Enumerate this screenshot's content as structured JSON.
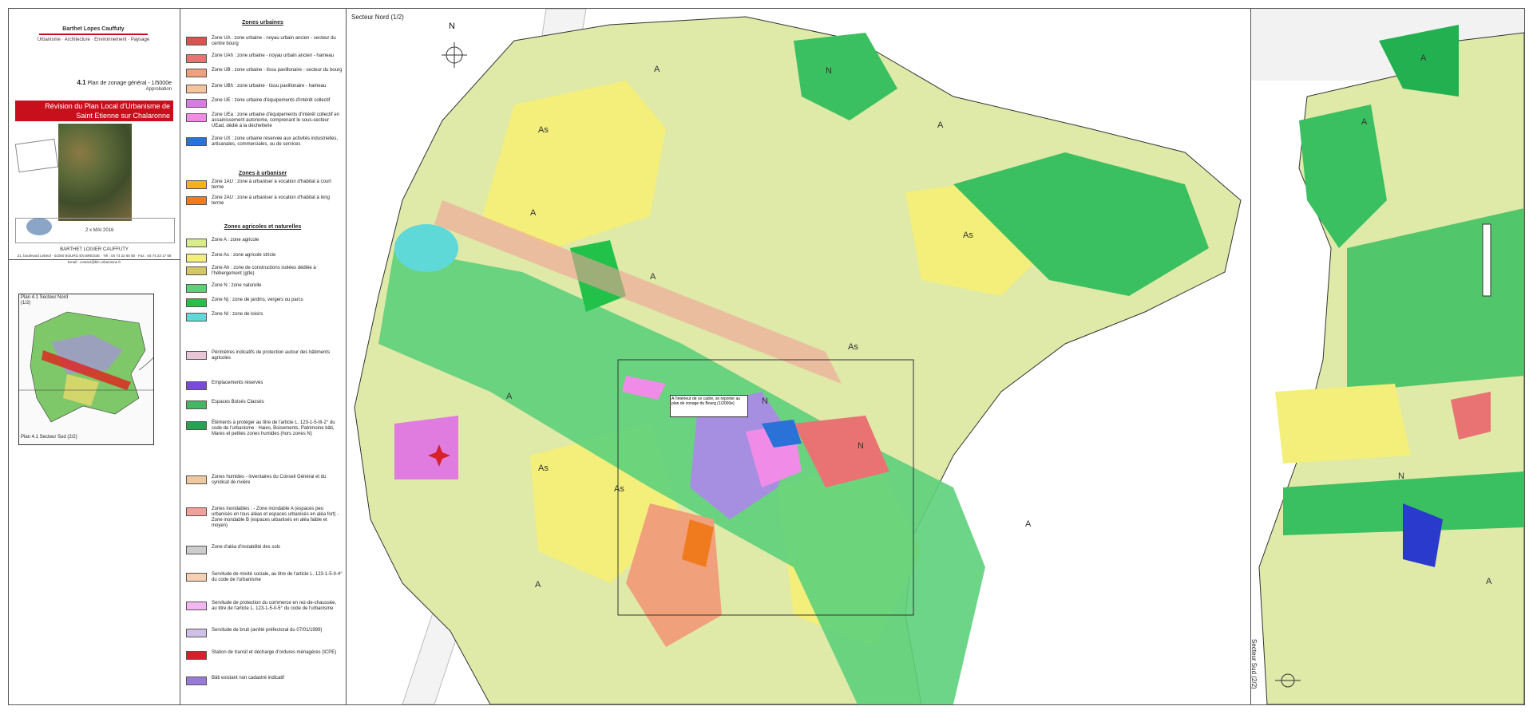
{
  "firm": {
    "name": "Barthet Lopes Cauffuty",
    "sub": "Urbanisme · Architecture · Environnement · Paysage",
    "footer_name": "BARTHET LOGIER CAUFFUTY",
    "footer_address": "21, boulevard Lebeuf · 01000 BOURG EN BRESSE · Tél : 04 74 22 60 80 · Fax : 04 74 23 17 68",
    "footer_email": "Email : contact@blc-urbanisme.fr"
  },
  "plan": {
    "number": "4.1",
    "title": "Plan de zonage général - 1/5000e",
    "stage": "Approbation",
    "banner_line1": "Révision du Plan Local d'Urbanisme de",
    "banner_line2": "Saint Etienne sur Chalaronne",
    "approval_date": "2 x MAI 2016"
  },
  "inset": {
    "north_label": "Plan 4.1 Secteur Nord",
    "north_sub": "(1/2)",
    "south_label": "Plan 4.1 Secteur Sud (2/2)"
  },
  "legend": {
    "urban_head": "Zones urbaines",
    "urban": [
      {
        "label": "Zone UA : zone urbaine - noyau urbain ancien - secteur du centre bourg",
        "color": "#d9534f"
      },
      {
        "label": "Zone UAh : zone urbaine - noyau urbain ancien - hameau",
        "color": "#e97373"
      },
      {
        "label": "Zone UB : zone urbaine - tissu pavillonaire - secteur du bourg",
        "color": "#f0a07a"
      },
      {
        "label": "Zone UBh : zone urbaine - tissu pavillonaire - hameau",
        "color": "#f6c49a"
      },
      {
        "label": "Zone UE : zone urbaine d'équipements d'intérêt collectif",
        "color": "#d77ce0"
      },
      {
        "label": "Zone UEa : zone urbaine d'équipements d'intérêt collectif en assainissement autonome, comprenant le sous-secteur UEad, dédié à la déchetterie",
        "color": "#f08ce8"
      },
      {
        "label": "Zone UX : zone urbaine réservée aux activités industrielles, artisanales, commerciales, ou de services",
        "color": "#2a72d8"
      }
    ],
    "au_head": "Zones à urbaniser",
    "au": [
      {
        "label": "Zone 1AU : zone à urbaniser à vocation d'habitat à court terme",
        "color": "#f4b21a"
      },
      {
        "label": "Zone 2AU : zone à urbaniser à vocation d'habitat à long terme",
        "color": "#f07a1e"
      }
    ],
    "nat_head": "Zones agricoles et naturelles",
    "nat": [
      {
        "label": "Zone A : zone agricole",
        "color": "#d9ec8a"
      },
      {
        "label": "Zone As : zone agricole stricte",
        "color": "#f3ef7a"
      },
      {
        "label": "Zone Ah : zone de constructions isolées dédiée à l'hébergement (gîte)",
        "color": "#d4c76a"
      },
      {
        "label": "Zone N : zone naturelle",
        "color": "#5dd07a"
      },
      {
        "label": "Zone Nj : zone de jardins, vergers ou parcs",
        "color": "#22c24a"
      },
      {
        "label": "Zone Nl : zone de loisirs",
        "color": "#5fd8d8"
      }
    ],
    "other": [
      {
        "label": "Périmètres indicatifs de protection autour des bâtiments agricoles",
        "color": "#e8c6d8"
      },
      {
        "label": "Emplacements réservés",
        "color": "#7a4ad8"
      },
      {
        "label": "Espaces Boisés Classés",
        "color": "#40b860"
      },
      {
        "label": "Éléments à protéger au titre de l'article L. 123-1-5-III-2° du code de l'urbanisme : Haies, Boisements, Patrimoine bâti, Mares et petites zones humides (hors zones N)",
        "color": "#2aa050"
      },
      {
        "label": "Zones humides - inventaires du Conseil Général et du syndicat de rivière",
        "color": "#f0c8a0"
      },
      {
        "label": "Zones inondables : - Zone inondable A (espaces peu urbanisés en tous aléas et espaces urbanisés en aléa fort) - Zone inondable B (espaces urbanisés en aléa faible et moyen)",
        "color": "#f2a09a"
      },
      {
        "label": "Zone d'aléa d'instabilité des sols",
        "color": "#cccccc"
      },
      {
        "label": "Servitude de mixité sociale, au titre de l'article L. 123-1-5-II-4° du code de l'urbanisme",
        "color": "#f6d0b0"
      },
      {
        "label": "Servitude de protection du commerce en rez-de-chaussée, au titre de l'article L. 123-1-5-II-5° du code de l'urbanisme",
        "color": "#f4b6f0"
      },
      {
        "label": "Servitude de bruit (arrêté préfectoral du 07/01/1999)",
        "color": "#cfc0e8"
      },
      {
        "label": "Station de transit et décharge d'ordures ménagères (ICPE)",
        "color": "#d8202a"
      },
      {
        "label": "Bâti existant non cadastré indicatif",
        "color": "#9a7ad8"
      }
    ]
  },
  "map": {
    "north_sector": "Secteur Nord (1/2)",
    "south_sector": "Secteur Sud (2/2)",
    "north_letter": "N",
    "callout": "A l'intérieur de ce cadre, se reporter au plan de zonage du Bourg (1/2000e)",
    "labels_A": "A",
    "labels_As": "As",
    "labels_N": "N"
  }
}
